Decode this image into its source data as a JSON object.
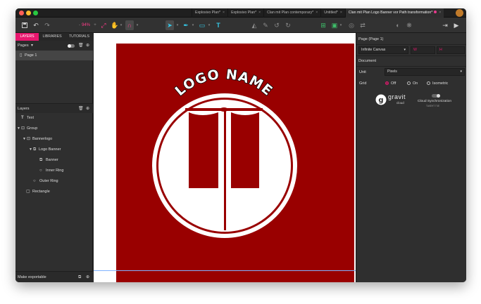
{
  "window": {
    "tabs": [
      {
        "label": "Explosivo Plan*",
        "active": false
      },
      {
        "label": "Explosivo Plan*",
        "active": false
      },
      {
        "label": "Clan mit Plan contemporary*",
        "active": false
      },
      {
        "label": "Untitled*",
        "active": false
      },
      {
        "label": "Clan mit Plan Logo Banner vor Path transformation*",
        "active": true
      }
    ],
    "tab_close": "×"
  },
  "toolbar": {
    "zoom": "94%",
    "text_tool": "T"
  },
  "left_panel": {
    "tabs": [
      "LAYERS",
      "LIBRARIES",
      "TUTORIALS"
    ],
    "pages_label": "Pages",
    "pages": [
      "Page 1"
    ],
    "layers_label": "Layers",
    "layers": [
      {
        "label": "Text",
        "icon": "text-icon"
      },
      {
        "label": "Group",
        "icon": "group-icon"
      },
      {
        "label": "Bannerlogo",
        "icon": "group-icon"
      },
      {
        "label": "Logo Banner",
        "icon": "compound-icon"
      },
      {
        "label": "Banner",
        "icon": "path-icon"
      },
      {
        "label": "Inner Ring",
        "icon": "ellipse-icon"
      },
      {
        "label": "Outer Ring",
        "icon": "ellipse-icon"
      },
      {
        "label": "Rectangle",
        "icon": "rectangle-icon"
      }
    ],
    "footer_label": "Make exportable"
  },
  "canvas": {
    "logo_text": "LOGO NAME",
    "artboard_color": "#990000"
  },
  "right_panel": {
    "page_title": "Page (Page 1)",
    "canvas_mode": "Infinite Canvas",
    "w_label": "W",
    "h_label": "H",
    "document_label": "Document",
    "unit_label": "Unit",
    "unit_value": "Pixels",
    "grid_label": "Grid",
    "grid_options": [
      "Off",
      "On",
      "Isometric"
    ],
    "grid_selected": "Off",
    "brand_name": "gravit",
    "brand_sub": "cloud",
    "sync_label": "Cloud Synchronization",
    "sync_sub": "ТАКЕНТ ГЧЕ"
  },
  "colors": {
    "accent": "#e8176e",
    "artboard": "#990000",
    "panel": "#2f2f2f"
  }
}
